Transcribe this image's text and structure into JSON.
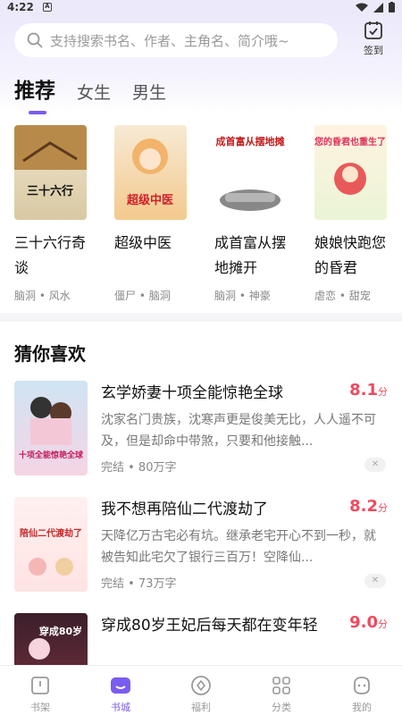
{
  "status": {
    "time": "4:22",
    "notif": "A"
  },
  "search": {
    "placeholder": "支持搜索书名、作者、主角名、简介哦~"
  },
  "signin": {
    "label": "签到"
  },
  "tabs": [
    {
      "label": "推荐",
      "active": true
    },
    {
      "label": "女生",
      "active": false
    },
    {
      "label": "男生",
      "active": false
    }
  ],
  "recommend": [
    {
      "title": "三十六行奇谈",
      "tags": "脑洞 • 风水",
      "cover_text": "三十六行"
    },
    {
      "title": "超级中医",
      "tags": "僵尸 • 脑洞",
      "cover_text": "超级中医"
    },
    {
      "title": "成首富从摆地摊开",
      "tags": "脑洞 • 神豪",
      "cover_text": "成首富从摆地摊"
    },
    {
      "title": "娘娘快跑您的昏君",
      "tags": "虐恋 • 甜宠",
      "cover_text": "您的昏君也重生了"
    }
  ],
  "section_title": "猜你喜欢",
  "books": [
    {
      "title": "玄学娇妻十项全能惊艳全球",
      "score": "8.1",
      "score_unit": "分",
      "desc": "沈家名门贵族，沈寒声更是俊美无比，人人遥不可及，但是却命中带煞，只要和他接触...",
      "meta": "完结 • 80万字",
      "cover_text": "十项全能惊艳全球"
    },
    {
      "title": "我不想再陪仙二代渡劫了",
      "score": "8.2",
      "score_unit": "分",
      "desc": "天降亿万古宅必有坑。继承老宅开心不到一秒，就被告知此宅欠了银行三百万！空降仙...",
      "meta": "完结 • 73万字",
      "cover_text": "陪仙二代渡劫了"
    },
    {
      "title": "穿成80岁王妃后每天都在变年轻",
      "score": "9.0",
      "score_unit": "分",
      "desc": "",
      "meta": "",
      "cover_text": "穿成80岁"
    }
  ],
  "nav": [
    {
      "label": "书架",
      "icon": "bookshelf-icon",
      "active": false
    },
    {
      "label": "书城",
      "icon": "bookstore-icon",
      "active": true
    },
    {
      "label": "福利",
      "icon": "welfare-icon",
      "active": false
    },
    {
      "label": "分类",
      "icon": "category-icon",
      "active": false
    },
    {
      "label": "我的",
      "icon": "profile-icon",
      "active": false
    }
  ],
  "colors": {
    "accent": "#7a5cf0",
    "score": "#f04a5e"
  }
}
